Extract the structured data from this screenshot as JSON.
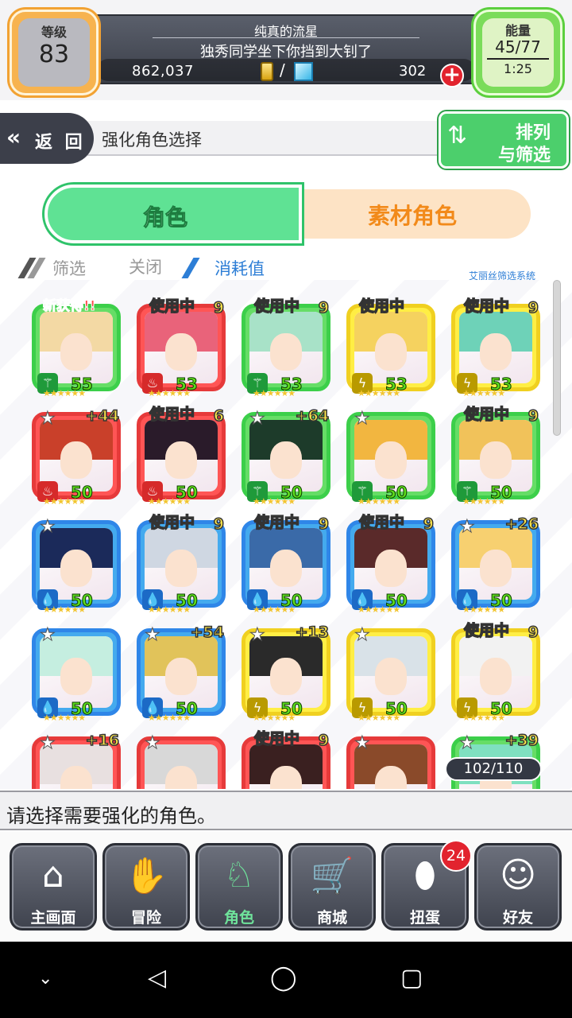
{
  "header": {
    "level_label": "等级",
    "level_value": "83",
    "player_name": "纯真的流星",
    "player_motto": "独秀同学坐下你挡到大钊了",
    "coins": "862,037",
    "currency_sep": "/",
    "gems": "302",
    "energy_label": "能量",
    "energy_value": "45/77",
    "energy_timer": "1:25"
  },
  "nav": {
    "back_label": "返 回",
    "page_title": "强化角色选择",
    "sort_line1": "排列",
    "sort_line2": "与筛选"
  },
  "tabs": [
    {
      "label": "角色",
      "active": true
    },
    {
      "label": "素材角色",
      "active": false
    }
  ],
  "filter": {
    "filter_label": "筛选",
    "filter_state": "关闭",
    "cost_label": "消耗值",
    "system_label": "艾丽丝筛选系统"
  },
  "cards": [
    {
      "color": "green",
      "level": "55",
      "tag": "新获得!!",
      "plus": "",
      "element": "wind",
      "stars": 6
    },
    {
      "color": "red",
      "level": "53",
      "tag": "使用中",
      "plus": "9",
      "element": "fire",
      "stars": 6
    },
    {
      "color": "green",
      "level": "53",
      "tag": "使用中",
      "plus": "9",
      "element": "wind",
      "stars": 6
    },
    {
      "color": "yellow",
      "level": "53",
      "tag": "使用中",
      "plus": "",
      "element": "thunder",
      "stars": 6
    },
    {
      "color": "yellow",
      "level": "53",
      "tag": "使用中",
      "plus": "9",
      "element": "thunder",
      "stars": 6
    },
    {
      "color": "red",
      "level": "50",
      "tag": "",
      "plus": "+44",
      "element": "fire",
      "stars": 6
    },
    {
      "color": "red",
      "level": "50",
      "tag": "使用中",
      "plus": "6",
      "element": "fire",
      "stars": 6
    },
    {
      "color": "green",
      "level": "50",
      "tag": "",
      "plus": "+64",
      "element": "wind",
      "stars": 6
    },
    {
      "color": "green",
      "level": "50",
      "tag": "",
      "plus": "",
      "element": "wind",
      "stars": 6
    },
    {
      "color": "green",
      "level": "50",
      "tag": "使用中",
      "plus": "9",
      "element": "wind",
      "stars": 6
    },
    {
      "color": "blue",
      "level": "50",
      "tag": "",
      "plus": "",
      "element": "water",
      "stars": 6
    },
    {
      "color": "blue",
      "level": "50",
      "tag": "使用中",
      "plus": "9",
      "element": "water",
      "stars": 6
    },
    {
      "color": "blue",
      "level": "50",
      "tag": "使用中",
      "plus": "9",
      "element": "water",
      "stars": 6
    },
    {
      "color": "blue",
      "level": "50",
      "tag": "使用中",
      "plus": "9",
      "element": "water",
      "stars": 6
    },
    {
      "color": "blue",
      "level": "50",
      "tag": "",
      "plus": "+26",
      "element": "water",
      "stars": 6
    },
    {
      "color": "blue",
      "level": "50",
      "tag": "",
      "plus": "",
      "element": "water",
      "stars": 6
    },
    {
      "color": "blue",
      "level": "50",
      "tag": "",
      "plus": "+54",
      "element": "water",
      "stars": 6
    },
    {
      "color": "yellow",
      "level": "50",
      "tag": "",
      "plus": "+13",
      "element": "thunder",
      "stars": 6
    },
    {
      "color": "yellow",
      "level": "50",
      "tag": "",
      "plus": "",
      "element": "thunder",
      "stars": 6
    },
    {
      "color": "yellow",
      "level": "50",
      "tag": "使用中",
      "plus": "9",
      "element": "thunder",
      "stars": 6
    },
    {
      "color": "red",
      "level": "",
      "tag": "",
      "plus": "+16",
      "element": "fire",
      "stars": 0
    },
    {
      "color": "red",
      "level": "",
      "tag": "",
      "plus": "",
      "element": "fire",
      "stars": 0
    },
    {
      "color": "red",
      "level": "",
      "tag": "使用中",
      "plus": "9",
      "element": "fire",
      "stars": 0
    },
    {
      "color": "red",
      "level": "",
      "tag": "",
      "plus": "",
      "element": "fire",
      "stars": 0
    },
    {
      "color": "green",
      "level": "",
      "tag": "",
      "plus": "+39",
      "element": "wind",
      "stars": 0
    }
  ],
  "card_count": "102/110",
  "hint": "请选择需要强化的角色。",
  "menu": [
    {
      "label": "主画面",
      "icon": "home-icon",
      "active": false
    },
    {
      "label": "冒险",
      "icon": "handshake-icon",
      "active": false
    },
    {
      "label": "角色",
      "icon": "rabbit-icon",
      "active": true
    },
    {
      "label": "商城",
      "icon": "cart-icon",
      "active": false
    },
    {
      "label": "扭蛋",
      "icon": "egg-icon",
      "active": false
    },
    {
      "label": "好友",
      "icon": "friends-icon",
      "active": false
    }
  ],
  "gacha_badge": "24"
}
